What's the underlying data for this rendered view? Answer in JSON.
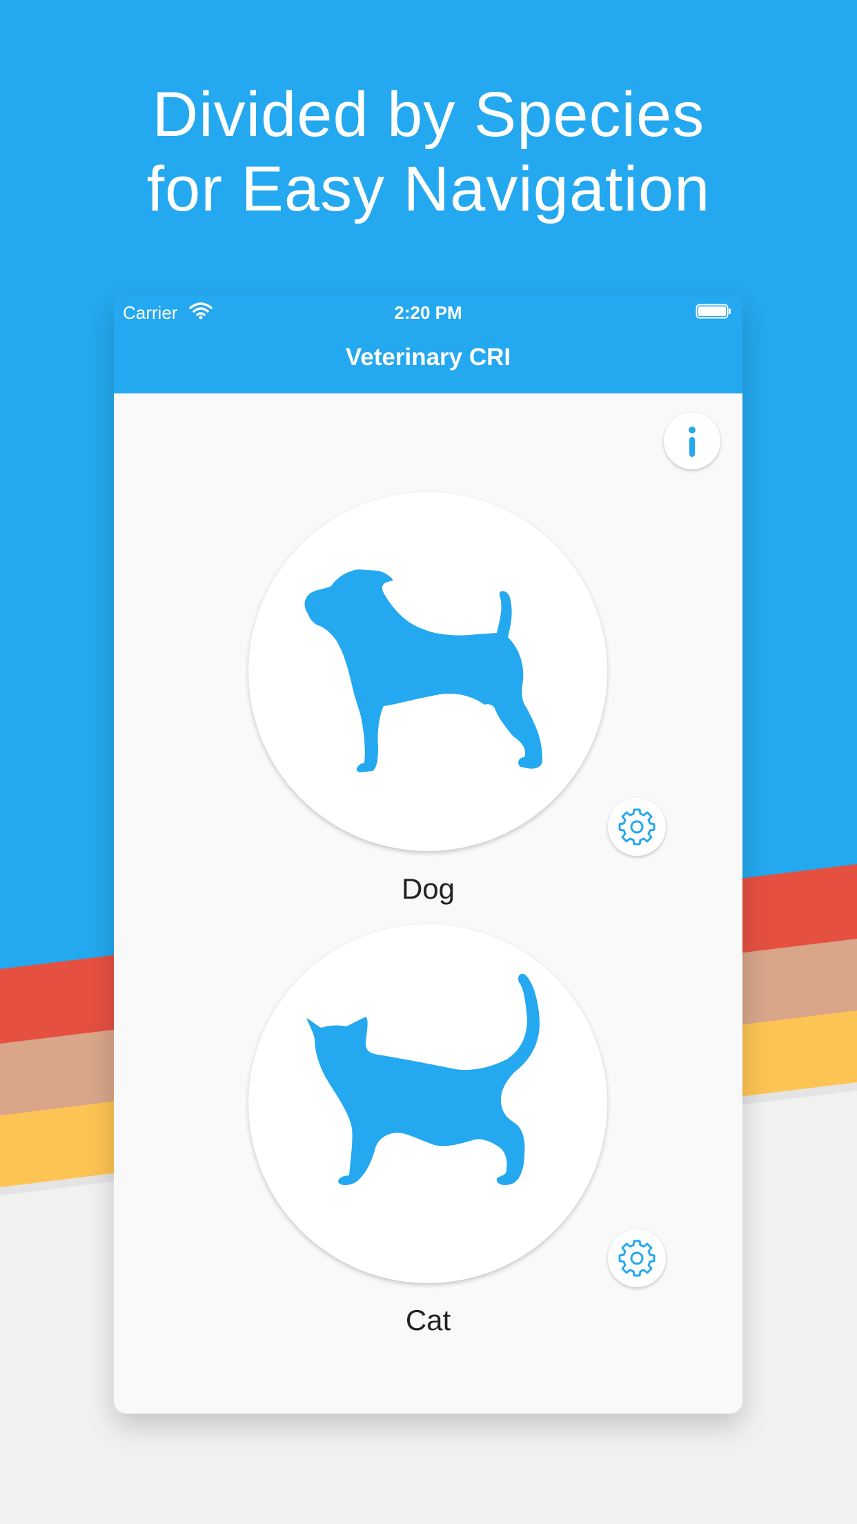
{
  "headline": {
    "line1": "Divided by Species",
    "line2": "for Easy Navigation"
  },
  "status_bar": {
    "carrier": "Carrier",
    "time": "2:20 PM"
  },
  "nav": {
    "title": "Veterinary CRI"
  },
  "info_button": {
    "icon": "info-icon"
  },
  "species": [
    {
      "label": "Dog",
      "icon": "dog-icon",
      "settings_icon": "gear-icon"
    },
    {
      "label": "Cat",
      "icon": "cat-icon",
      "settings_icon": "gear-icon"
    }
  ],
  "colors": {
    "brand_blue": "#24a8ef",
    "stripe_red": "#e55040",
    "stripe_tan": "#d9a68a",
    "stripe_yellow": "#fdc453",
    "background": "#f1f1f1",
    "card": "#f9f9f9"
  }
}
